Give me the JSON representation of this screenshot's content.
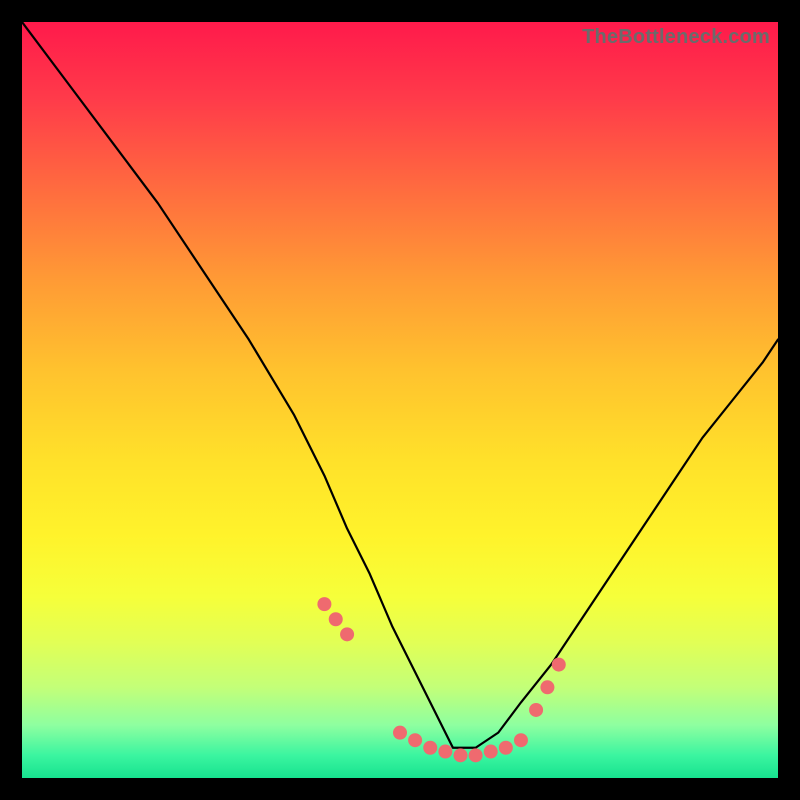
{
  "watermark": "TheBottleneck.com",
  "chart_data": {
    "type": "line",
    "title": "",
    "xlabel": "",
    "ylabel": "",
    "xlim": [
      0,
      100
    ],
    "ylim": [
      0,
      100
    ],
    "grid": false,
    "legend": false,
    "background_gradient": {
      "top_color": "#ff1a4b",
      "bottom_color": "#17e28f",
      "description": "vertical rainbow gradient: red (top) → orange → yellow → green (bottom)"
    },
    "series": [
      {
        "name": "bottleneck-curve",
        "description": "V-shaped curve; high at x=0, descends to minimum near x≈57, rises toward right edge",
        "x": [
          0,
          6,
          12,
          18,
          24,
          30,
          36,
          40,
          43,
          46,
          49,
          52,
          55,
          57,
          60,
          63,
          66,
          70,
          74,
          78,
          82,
          86,
          90,
          94,
          98,
          100
        ],
        "values": [
          100,
          92,
          84,
          76,
          67,
          58,
          48,
          40,
          33,
          27,
          20,
          14,
          8,
          4,
          4,
          6,
          10,
          15,
          21,
          27,
          33,
          39,
          45,
          50,
          55,
          58
        ]
      }
    ],
    "markers": {
      "name": "highlight-dots",
      "color": "#ef6a6f",
      "radius": 7,
      "x": [
        40,
        41.5,
        43,
        50,
        52,
        54,
        56,
        58,
        60,
        62,
        64,
        66,
        68,
        69.5,
        71
      ],
      "values": [
        23,
        21,
        19,
        6,
        5,
        4,
        3.5,
        3,
        3,
        3.5,
        4,
        5,
        9,
        12,
        15
      ]
    }
  }
}
